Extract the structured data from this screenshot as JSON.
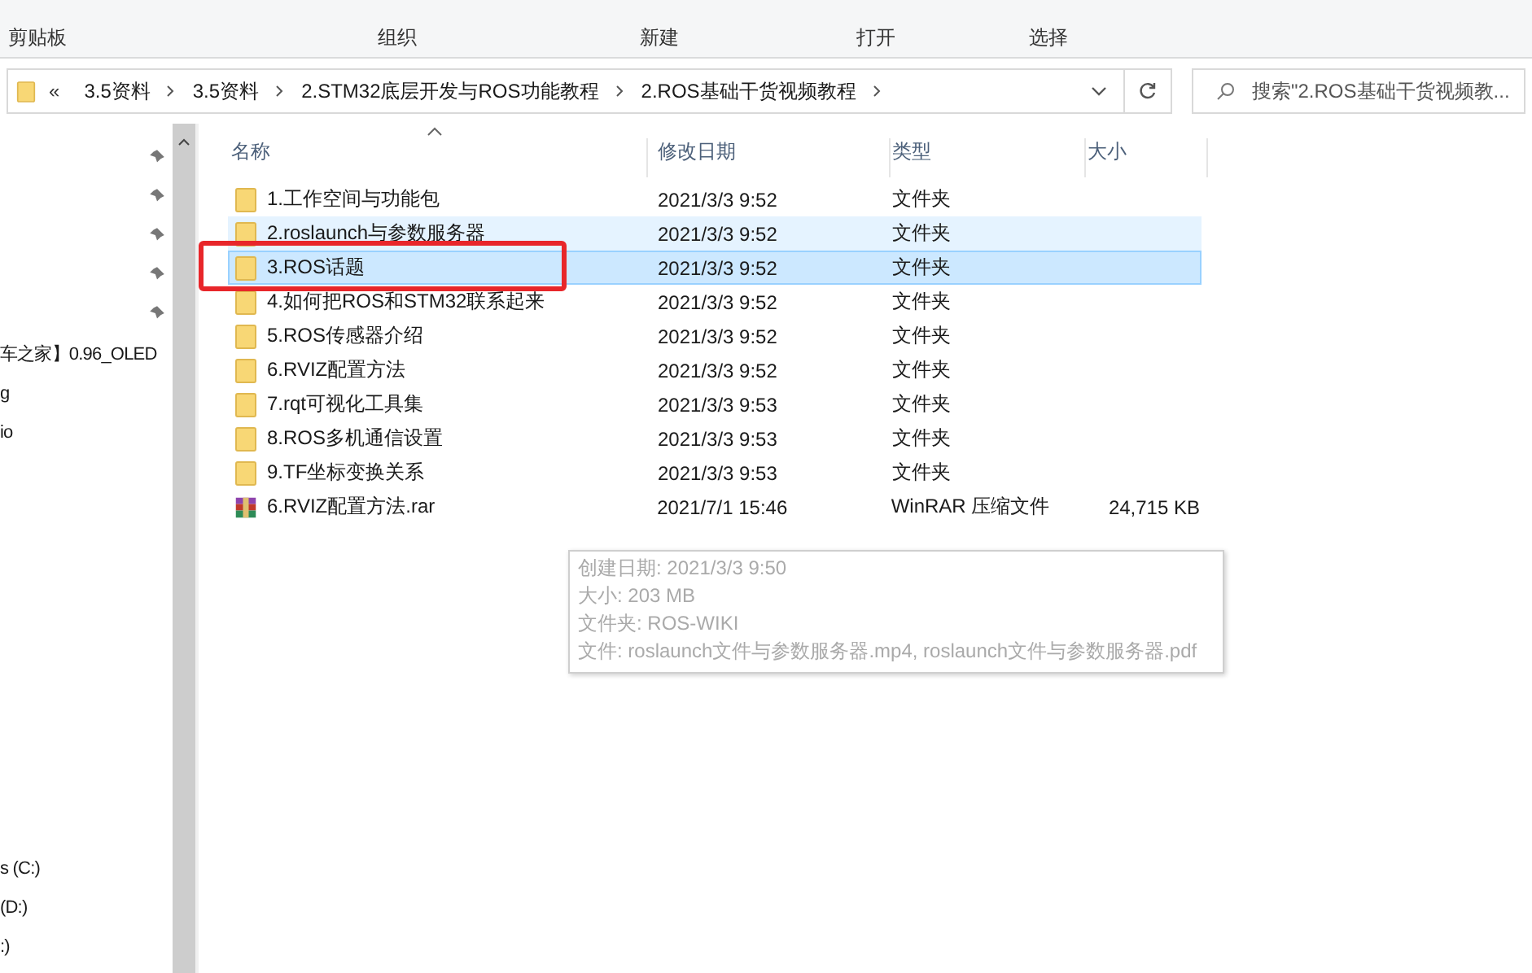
{
  "ribbon": {
    "groups": [
      {
        "label": "剪贴板"
      },
      {
        "label": "组织"
      },
      {
        "label": "新建"
      },
      {
        "label": "打开"
      },
      {
        "label": "选择"
      }
    ]
  },
  "address_bar": {
    "overflow": "«",
    "crumbs": [
      "3.5资料",
      "3.5资料",
      "2.STM32底层开发与ROS功能教程",
      "2.ROS基础干货视频教程"
    ]
  },
  "search": {
    "placeholder": "搜索\"2.ROS基础干货视频教..."
  },
  "nav_pane": {
    "pinned_items": [
      {
        "pinned": true
      },
      {
        "pinned": true
      },
      {
        "pinned": true
      },
      {
        "pinned": true
      },
      {
        "pinned": true
      }
    ],
    "items": [
      "车之家】0.96_OLED",
      "g",
      "io"
    ],
    "drives": [
      "s (C:)",
      "(D:)",
      ":)"
    ]
  },
  "table": {
    "columns": [
      "名称",
      "修改日期",
      "类型",
      "大小"
    ],
    "rows": [
      {
        "kind": "folder",
        "name": "1.工作空间与功能包",
        "date": "2021/3/3 9:52",
        "type": "文件夹",
        "hovered": false,
        "selected": false,
        "marked": false
      },
      {
        "kind": "folder",
        "name": "2.roslaunch与参数服务器",
        "date": "2021/3/3 9:52",
        "type": "文件夹",
        "hovered": true,
        "selected": false,
        "marked": false
      },
      {
        "kind": "folder",
        "name": "3.ROS话题",
        "date": "2021/3/3 9:52",
        "type": "文件夹",
        "hovered": false,
        "selected": true,
        "marked": true
      },
      {
        "kind": "folder",
        "name": "4.如何把ROS和STM32联系起来",
        "date": "2021/3/3 9:52",
        "type": "文件夹",
        "hovered": false,
        "selected": false,
        "marked": false
      },
      {
        "kind": "folder",
        "name": "5.ROS传感器介绍",
        "date": "2021/3/3 9:52",
        "type": "文件夹",
        "hovered": false,
        "selected": false,
        "marked": false
      },
      {
        "kind": "folder",
        "name": "6.RVIZ配置方法",
        "date": "2021/3/3 9:52",
        "type": "文件夹",
        "hovered": false,
        "selected": false,
        "marked": false
      },
      {
        "kind": "folder",
        "name": "7.rqt可视化工具集",
        "date": "2021/3/3 9:53",
        "type": "文件夹",
        "hovered": false,
        "selected": false,
        "marked": false
      },
      {
        "kind": "folder",
        "name": "8.ROS多机通信设置",
        "date": "2021/3/3 9:53",
        "type": "文件夹",
        "hovered": false,
        "selected": false,
        "marked": false
      },
      {
        "kind": "folder",
        "name": "9.TF坐标变换关系",
        "date": "2021/3/3 9:53",
        "type": "文件夹",
        "hovered": false,
        "selected": false,
        "marked": false
      },
      {
        "kind": "archive",
        "name": "6.RVIZ配置方法.rar",
        "date": "2021/7/1 15:46",
        "type": "WinRAR 压缩文件",
        "size": "24,715 KB",
        "hovered": false,
        "selected": false,
        "marked": false
      }
    ]
  },
  "tooltip": {
    "lines": [
      "创建日期: 2021/3/3 9:50",
      "大小: 203 MB",
      "文件夹: ROS-WIKI",
      "文件: roslaunch文件与参数服务器.mp4, roslaunch文件与参数服务器.pdf"
    ]
  }
}
